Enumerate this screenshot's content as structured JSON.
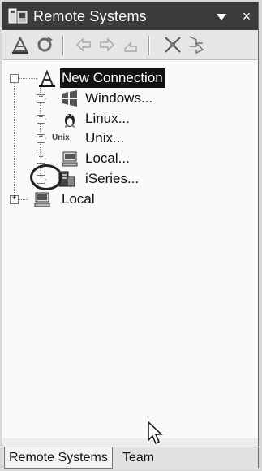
{
  "window": {
    "title": "Remote Systems",
    "menu_icon": "view-menu-triangle",
    "close_label": "×"
  },
  "toolbar": {
    "buttons": [
      {
        "name": "new-connection-icon"
      },
      {
        "name": "refresh-icon"
      },
      {
        "name": "back-arrow-icon"
      },
      {
        "name": "forward-arrow-icon"
      },
      {
        "name": "up-arrow-icon"
      },
      {
        "name": "collapse-all-icon"
      },
      {
        "name": "link-with-editor-icon"
      }
    ]
  },
  "tree": {
    "root_new_connection": "New Connection",
    "children": [
      "Windows...",
      "Linux...",
      "Unix...",
      "Local...",
      "iSeries..."
    ],
    "unix_badge": "Unix",
    "root_local": "Local"
  },
  "tabs": {
    "remote_systems": "Remote Systems",
    "team": "Team"
  }
}
